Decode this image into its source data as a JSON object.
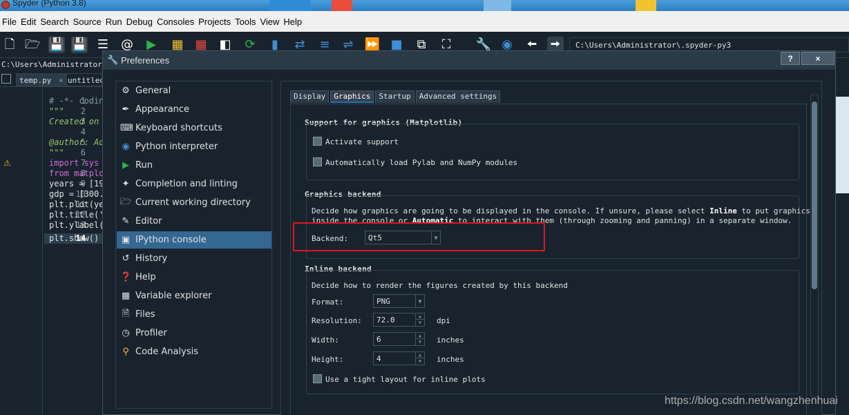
{
  "window": {
    "title": "Spyder (Python 3.8)"
  },
  "menu": [
    "File",
    "Edit",
    "Search",
    "Source",
    "Run",
    "Debug",
    "Consoles",
    "Projects",
    "Tools",
    "View",
    "Help"
  ],
  "toolbar": {
    "path": "C:\\Users\\Administrator\\.spyder-py3"
  },
  "editor": {
    "path": "C:\\Users\\Administrator\\.",
    "tabs": [
      "temp.py",
      "untitled"
    ],
    "tab_close": "×",
    "line_numbers": [
      "1",
      "2",
      "3",
      "4",
      "5",
      "6",
      "7",
      "8",
      "9",
      "10",
      "11",
      "12",
      "13",
      "14"
    ],
    "lines": [
      "# -*- codin",
      "\"\"\"",
      "Created on",
      "",
      "@author: Ad",
      "\"\"\"",
      "import sys",
      "from matplo",
      "years = [19",
      "gdp = [300.",
      "plt.plot(ye",
      "plt.title('",
      "plt.ylabel(",
      "plt.show()"
    ]
  },
  "dialog": {
    "title": "Preferences",
    "help_label": "?",
    "close_label": "×",
    "sidebar": [
      "General",
      "Appearance",
      "Keyboard shortcuts",
      "Python interpreter",
      "Run",
      "Completion and linting",
      "Current working directory",
      "Editor",
      "IPython console",
      "History",
      "Help",
      "Variable explorer",
      "Files",
      "Profiler",
      "Code Analysis"
    ],
    "selected_index": 8,
    "tabs": [
      "Display",
      "Graphics",
      "Startup",
      "Advanced settings"
    ],
    "active_tab": "Graphics",
    "support": {
      "title": "Support for graphics (Matplotlib)",
      "activate": "Activate support",
      "pylab": "Automatically load Pylab and NumPy modules"
    },
    "backend": {
      "title": "Graphics backend",
      "desc1_a": "Decide how graphics are going to be displayed in the console. If unsure, please select ",
      "desc1_b": "Inline",
      "desc1_c": " to put graphics",
      "desc2_a": "inside the console or ",
      "desc2_b": "Automatic",
      "desc2_c": " to interact with them (through zooming and panning) in a separate window.",
      "label": "Backend:",
      "value": "Qt5"
    },
    "inline": {
      "title": "Inline backend",
      "desc": "Decide how to render the figures created by this backend",
      "format_label": "Format:",
      "format_value": "PNG",
      "resolution_label": "Resolution:",
      "resolution_value": "72.0",
      "resolution_unit": "dpi",
      "width_label": "Width:",
      "width_value": "6",
      "width_unit": "inches",
      "height_label": "Height:",
      "height_value": "4",
      "height_unit": "inches",
      "tight": "Use a tight layout for inline plots"
    }
  },
  "watermark": "https://blog.csdn.net/wangzhenhuai",
  "colors": {
    "accent": "#346792",
    "highlight": "#e0141e",
    "background": "#19232d"
  }
}
